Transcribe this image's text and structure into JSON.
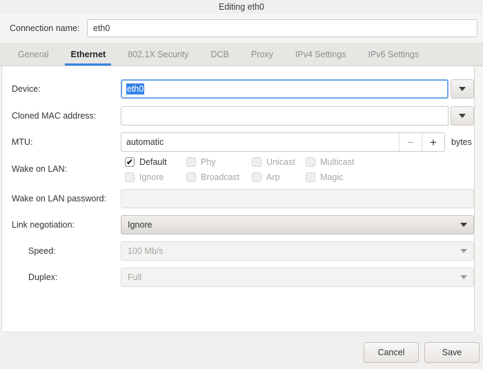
{
  "window": {
    "title": "Editing eth0"
  },
  "connection_name": {
    "label": "Connection name:",
    "value": "eth0"
  },
  "tabs": [
    {
      "label": "General",
      "active": false
    },
    {
      "label": "Ethernet",
      "active": true
    },
    {
      "label": "802.1X Security",
      "active": false
    },
    {
      "label": "DCB",
      "active": false
    },
    {
      "label": "Proxy",
      "active": false
    },
    {
      "label": "IPv4 Settings",
      "active": false
    },
    {
      "label": "IPv6 Settings",
      "active": false
    }
  ],
  "form": {
    "device": {
      "label": "Device:",
      "value": "eth0",
      "selected": true,
      "focused": true
    },
    "cloned_mac": {
      "label": "Cloned MAC address:",
      "value": ""
    },
    "mtu": {
      "label": "MTU:",
      "value": "automatic",
      "decrement": "−",
      "increment": "+",
      "unit": "bytes"
    },
    "wake_on_lan": {
      "label": "Wake on LAN:",
      "options": [
        {
          "label": "Default",
          "checked": true,
          "enabled": true
        },
        {
          "label": "Phy",
          "checked": false,
          "enabled": false
        },
        {
          "label": "Unicast",
          "checked": false,
          "enabled": false
        },
        {
          "label": "Multicast",
          "checked": false,
          "enabled": false
        },
        {
          "label": "Ignore",
          "checked": false,
          "enabled": false
        },
        {
          "label": "Broadcast",
          "checked": false,
          "enabled": false
        },
        {
          "label": "Arp",
          "checked": false,
          "enabled": false
        },
        {
          "label": "Magic",
          "checked": false,
          "enabled": false
        }
      ],
      "check_glyph": "✔"
    },
    "wol_password": {
      "label": "Wake on LAN password:",
      "value": ""
    },
    "link_negotiation": {
      "label": "Link negotiation:",
      "value": "Ignore",
      "enabled": true
    },
    "speed": {
      "label": "Speed:",
      "value": "100 Mb/s",
      "enabled": false
    },
    "duplex": {
      "label": "Duplex:",
      "value": "Full",
      "enabled": false
    }
  },
  "footer": {
    "cancel": "Cancel",
    "save": "Save"
  },
  "colors": {
    "accent": "#3584e4",
    "selection": "#3584e4",
    "window_bg": "#f5f5f4",
    "panel_bg": "#ffffff"
  }
}
